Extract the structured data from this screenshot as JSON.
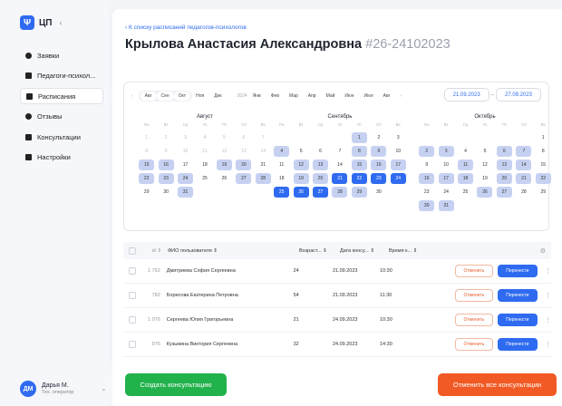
{
  "app": {
    "logo_icon": "Ψ",
    "logo_text": "ЦП",
    "collapse": "‹"
  },
  "nav": [
    {
      "label": "Заявки",
      "icon": "flame-icon"
    },
    {
      "label": "Педагоги-психол...",
      "icon": "document-icon"
    },
    {
      "label": "Расписания",
      "icon": "calendar-icon",
      "active": true
    },
    {
      "label": "Отзывы",
      "icon": "chat-icon"
    },
    {
      "label": "Консультации",
      "icon": "book-icon"
    },
    {
      "label": "Настройки",
      "icon": "gear-icon"
    }
  ],
  "user": {
    "initials": "ДМ",
    "name": "Дарья М.",
    "role": "Тех. оператор",
    "chevron": "⌄"
  },
  "header": {
    "back": "‹ К списку расписаний педагогов-психологов",
    "name": "Крылова Анастасия Александровна",
    "id": "#26-24102023"
  },
  "calendar": {
    "months_bar": {
      "arrow_left": "‹",
      "selected": [
        "Авг",
        "Сен",
        "Окт"
      ],
      "rest_2023": [
        "Ноя",
        "Дек"
      ],
      "year": "2024",
      "rest_2024": [
        "Янв",
        "Фев",
        "Мар",
        "Апр",
        "Май",
        "Июн",
        "Июл",
        "Авг"
      ],
      "arrow_right": "›"
    },
    "date_from": "21.09.2023",
    "dash": "–",
    "date_to": "27.09.2023",
    "weekdays": [
      "Пн",
      "Вт",
      "Ср",
      "Чт",
      "Пт",
      "Сб",
      "Вс"
    ],
    "months": [
      {
        "name": "Август",
        "lead": [],
        "days": 31,
        "trail": [],
        "offset": 0,
        "highlight": [
          15,
          16,
          19,
          20,
          22,
          23,
          24,
          27,
          28,
          31
        ],
        "selected": []
      },
      {
        "name": "Сентябрь",
        "lead": [],
        "days": 30,
        "offset": 4,
        "highlight": [
          1,
          4,
          8,
          9,
          12,
          13,
          15,
          16,
          17,
          19,
          20,
          28,
          29
        ],
        "selected": [
          21,
          22,
          23,
          24,
          25,
          26,
          27
        ]
      },
      {
        "name": "Октябрь",
        "lead": [],
        "days": 31,
        "offset": 6,
        "highlight": [
          2,
          3,
          6,
          7,
          11,
          13,
          14,
          16,
          17,
          18,
          20,
          21,
          22,
          26,
          27,
          30,
          31
        ],
        "selected": []
      }
    ],
    "month_x": [
      14,
      163,
      323
    ]
  },
  "table": {
    "columns": {
      "id": "id ⇕",
      "name": "ФИО пользователя ⇕",
      "age": "Возраст... ⇕",
      "date": "Дата консу... ⇕",
      "time": "Время к... ⇕"
    },
    "rows": [
      {
        "id": "1 762",
        "name": "Дмитриева София Сергеевна",
        "age": "24",
        "date": "21.09.2023",
        "time": "10:30"
      },
      {
        "id": "782",
        "name": "Борисова Екатерина Петровна",
        "age": "54",
        "date": "21.09.2023",
        "time": "11:30"
      },
      {
        "id": "1 076",
        "name": "Сергеева Юлия Григорьевна",
        "age": "21",
        "date": "24.09.2023",
        "time": "10:30"
      },
      {
        "id": "976",
        "name": "Кузьмина Виктория Сергеевна",
        "age": "32",
        "date": "24.09.2023",
        "time": "14:30"
      }
    ],
    "cancel_label": "Отменить",
    "move_label": "Перенести",
    "more": "⋮",
    "gear": "⚙"
  },
  "footer": {
    "create": "Создать консультацию",
    "cancel_all": "Отменить все консультации"
  },
  "colors": {
    "accent": "#2f6bf0",
    "green": "#22b24c",
    "orange": "#f15a24",
    "highlight": "#c6d1f2"
  }
}
